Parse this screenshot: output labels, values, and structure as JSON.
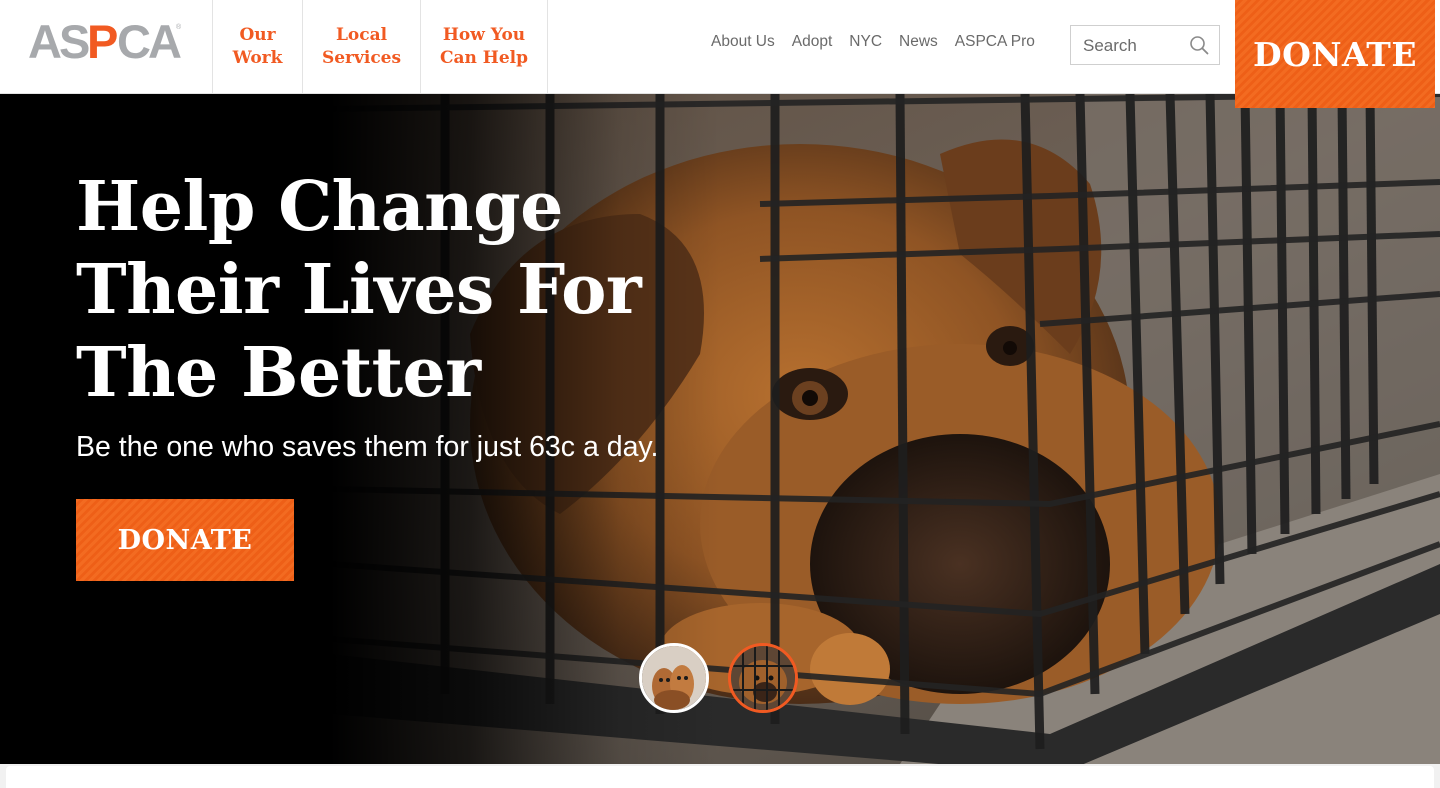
{
  "brand": {
    "logo_text": "ASPCA",
    "primary_color": "#f15a22",
    "logo_gray": "#a7a9ac"
  },
  "header": {
    "main_nav": [
      {
        "label": "Our\nWork"
      },
      {
        "label": "Local\nServices"
      },
      {
        "label": "How You\nCan Help"
      }
    ],
    "utility_nav": [
      "About Us",
      "Adopt",
      "NYC",
      "News",
      "ASPCA Pro"
    ],
    "search": {
      "placeholder": "Search",
      "icon": "search-icon"
    },
    "donate_label": "DONATE"
  },
  "hero": {
    "title": "Help Change\nTheir Lives For\nThe Better",
    "subtitle": "Be the one who saves them for just 63c a day.",
    "cta_label": "DONATE",
    "slides": [
      {
        "thumb": "dogs-group-thumbnail",
        "active": false
      },
      {
        "thumb": "caged-dog-thumbnail",
        "active": true
      }
    ]
  }
}
